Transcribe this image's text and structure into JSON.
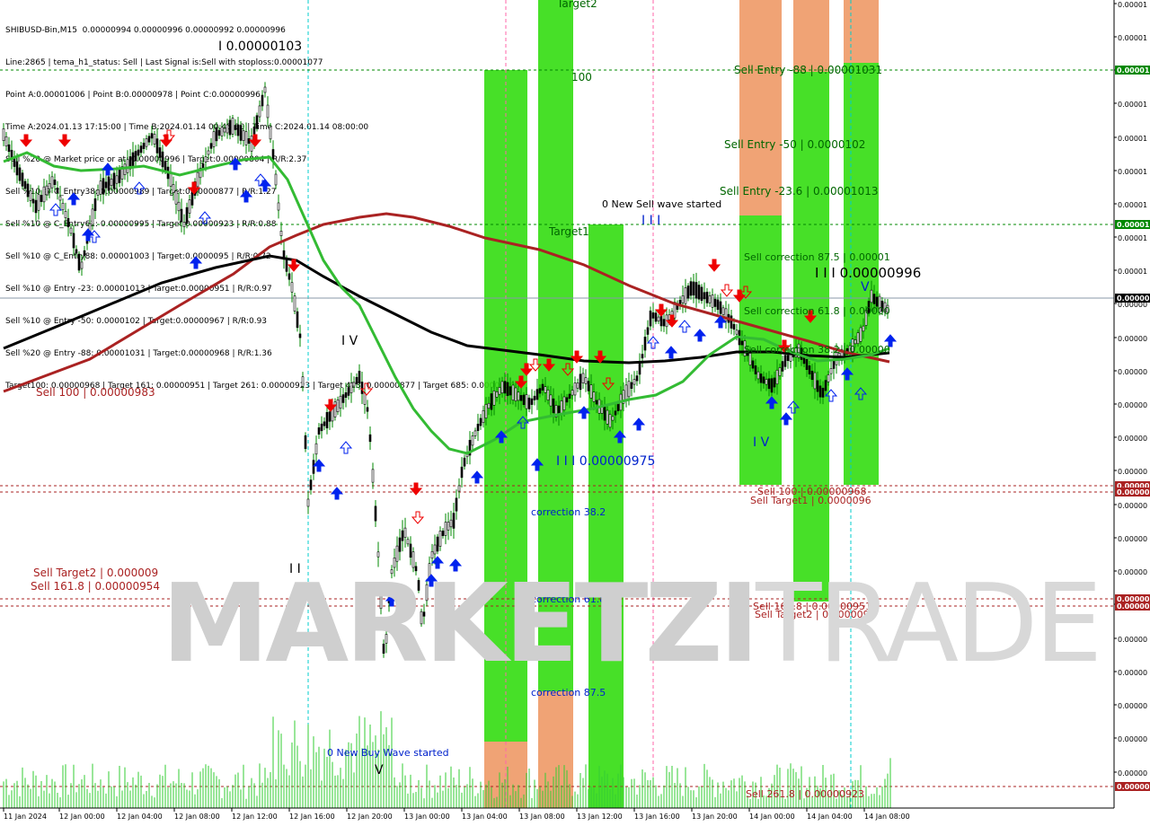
{
  "header": {
    "lines": [
      "SHIBUSD-Bin,M15  0.00000994 0.00000996 0.00000992 0.00000996",
      "Line:2865 | tema_h1_status: Sell | Last Signal is:Sell with stoploss:0.00001077",
      "Point A:0.00001006 | Point B:0.00000978 | Point C:0.00000996",
      "Time A:2024.01.13 17:15:00 | Time B:2024.01.14 00:45:00 | Time C:2024.01.14 08:00:00",
      "Sell %20 @ Market price or at: 0.00000996 | Target:0.00000804 | R/R:2.37",
      "Sell %10 @ C_Entry38: 0.00000989 | Target:0.00000877 | R/R:1.27",
      "Sell %10 @ C_Entry61: 0.00000995 | Target:0.00000923 | R/R:0.88",
      "Sell %10 @ C_Entry88: 0.00001003 | Target:0.0000095 | R/R:0.72",
      "Sell %10 @ Entry -23: 0.00001013 | Target:0.00000951 | R/R:0.97",
      "Sell %10 @ Entry -50: 0.0000102 | Target:0.00000967 | R/R:0.93",
      "Sell %20 @ Entry -88: 0.00001031 | Target:0.00000968 | R/R:1.36",
      "Target100: 0.00000968 | Target 161: 0.00000951 | Target 261: 0.00000923 | Target 423: 0.00000877 | Target 685: 0.00000804"
    ]
  },
  "watermark": {
    "bold": "MARKETZI",
    "light": "TRADE"
  },
  "colors": {
    "green_zone": "#33dd11",
    "orange_zone": "#ee9966",
    "ma_fast": "#33bb33",
    "ma_slow": "#000000",
    "ma_red": "#aa2222",
    "level_red": "#aa2222",
    "level_green": "#008800",
    "buy_arrow": "#0022ee",
    "sell_arrow": "#ee0000",
    "candle": "#008800",
    "price_bg": "#000000"
  },
  "chart_data": {
    "type": "candlestick",
    "symbol": "SHIBUSD-Bin",
    "timeframe": "M15",
    "ylim": [
      9.12e-06,
      1.055e-05
    ],
    "current_price": 9.96e-06,
    "x_labels": [
      "11 Jan 2024",
      "12 Jan 00:00",
      "12 Jan 04:00",
      "12 Jan 08:00",
      "12 Jan 12:00",
      "12 Jan 16:00",
      "12 Jan 20:00",
      "13 Jan 00:00",
      "13 Jan 04:00",
      "13 Jan 08:00",
      "13 Jan 12:00",
      "13 Jan 16:00",
      "13 Jan 20:00",
      "14 Jan 00:00",
      "14 Jan 04:00",
      "14 Jan 08:00"
    ],
    "price_axis_labels": [
      "0.00001",
      "0.00001",
      "0.00001",
      "0.00001",
      "0.00001",
      "0.00001",
      "0.00001",
      "0.00001",
      "0.00001",
      "0.00000",
      "0.00000",
      "0.00000",
      "0.00000",
      "0.00000",
      "0.00000",
      "0.00000",
      "0.00000",
      "0.00000",
      "0.00000",
      "0.00000",
      "0.00000",
      "0.00000",
      "0.00000",
      "0.00000"
    ],
    "highlight_labels": {
      "green_top": "0.00001",
      "green_mid": "0.00001",
      "current": "0.00000",
      "red_1": "0.00000",
      "red_2": "0.00000",
      "red_3": "0.00000",
      "red_4": "0.00000",
      "red_bottom": "0.00000"
    },
    "levels": [
      {
        "label": "Sell Entry -88 | 0.00001031",
        "value": 1.031e-05
      },
      {
        "label": "Sell Entry -50 | 0.0000102",
        "value": 1.02e-05
      },
      {
        "label": "Sell Entry -23.6 | 0.00001013",
        "value": 1.013e-05
      },
      {
        "label": "Sell correction 87.5 | 0.00001",
        "value": 1e-05
      },
      {
        "label": "Sell correction 61.8 | 0.00000",
        "value": 9.95e-06
      },
      {
        "label": "Sell correction 38.2 | 0.00000",
        "value": 9.89e-06
      },
      {
        "label": "Sell 100 | 0.00000968",
        "value": 9.68e-06
      },
      {
        "label": "Sell Target1 | 0.0000096",
        "value": 9.6e-06
      },
      {
        "label": "Sell 161.8 | 0.00000951",
        "value": 9.51e-06
      },
      {
        "label": "Sell Target2 | 0.000009",
        "value": 9e-06
      },
      {
        "label": "Sell 261.8 | 0.00000923",
        "value": 9.23e-06
      }
    ],
    "annotations": {
      "target2": "Target2",
      "hundred": "100",
      "target1": "Target1",
      "new_sell": "0 New Sell wave started",
      "new_buy": "0 New Buy Wave started",
      "wave_iii_top": "I I I",
      "wave_c": "I I I 0.00000996",
      "wave_v": "V",
      "wave_iv": "I V",
      "wave_iv_left": "I V",
      "wave_iii_low": "I I I 0.00000975",
      "wave_i_top": "I 0.00000103",
      "wave_ii": "I I",
      "wave_v_low": "V",
      "corr38": "correction 38.2",
      "corr61": "correction 61.8",
      "corr87": "correction 87.5",
      "sell100_left": "Sell 100 | 0.00000983",
      "sell_target2_left": "Sell Target2 | 0.000009",
      "sell161_left": "Sell 161.8 | 0.00000954"
    }
  }
}
